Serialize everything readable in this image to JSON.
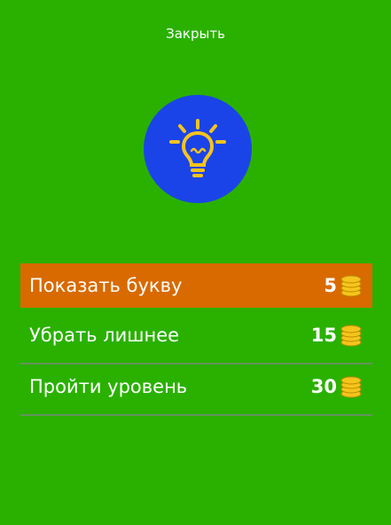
{
  "header": {
    "close_label": "Закрыть"
  },
  "hint": {
    "icon": "lightbulb-icon",
    "circle_color": "#1b44e8",
    "icon_color": "#f6c41c"
  },
  "options": [
    {
      "label": "Показать букву",
      "price": "5",
      "icon": "coins-icon",
      "selected": true
    },
    {
      "label": "Убрать лишнее",
      "price": "15",
      "icon": "coins-icon",
      "selected": false
    },
    {
      "label": "Пройти уровень",
      "price": "30",
      "icon": "coins-icon",
      "selected": false
    }
  ],
  "colors": {
    "background": "#2ab100",
    "selected": "#d86a00",
    "text": "#ffffff"
  }
}
